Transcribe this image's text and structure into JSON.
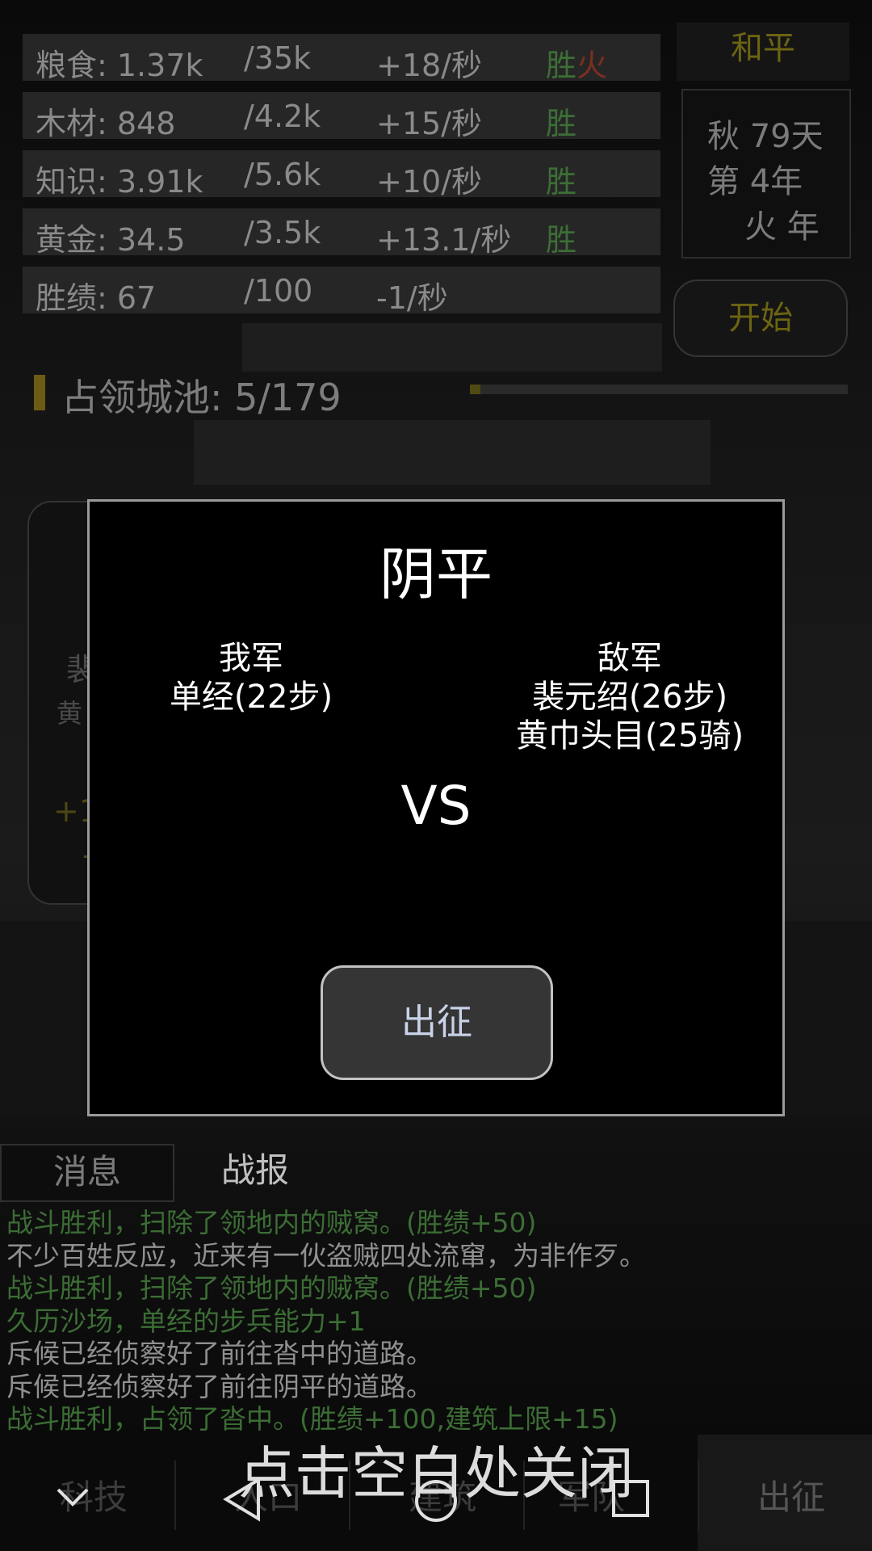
{
  "resources": [
    {
      "name": "粮食: 1.37k",
      "max": "/35k",
      "rate": "+18/秒",
      "status": "胜",
      "status_extra": "火"
    },
    {
      "name": "木材: 848",
      "max": "/4.2k",
      "rate": "+15/秒",
      "status": "胜",
      "status_extra": ""
    },
    {
      "name": "知识: 3.91k",
      "max": "/5.6k",
      "rate": "+10/秒",
      "status": "胜",
      "status_extra": ""
    },
    {
      "name": "黄金: 34.5",
      "max": "/3.5k",
      "rate": "+13.1/秒",
      "status": "胜",
      "status_extra": ""
    },
    {
      "name": "胜绩: 67",
      "max": "/100",
      "rate": "-1/秒",
      "status": "",
      "status_extra": ""
    }
  ],
  "header": {
    "peace": "和平",
    "season_day": "秋 79天",
    "year": "第 4年",
    "element_year": "火 年",
    "start_button": "开始"
  },
  "cities": {
    "label": "占领城池: 5/179",
    "progress_fraction": 0.028
  },
  "side_card": {
    "line1": "裴",
    "line2": "黄",
    "line3": "+1",
    "line4": "-"
  },
  "modal": {
    "title": "阴平",
    "my_side": {
      "label": "我军",
      "units": [
        "单经(22步)"
      ]
    },
    "enemy_side": {
      "label": "敌军",
      "units": [
        "裴元绍(26步)",
        "黄巾头目(25骑)"
      ]
    },
    "vs": "VS",
    "go_button": "出征"
  },
  "tabs": {
    "messages": "消息",
    "battle_report": "战报"
  },
  "log": [
    {
      "text": "战斗胜利，扫除了领地内的贼窝。(胜绩+50)",
      "type": "green"
    },
    {
      "text": "不少百姓反应，近来有一伙盗贼四处流窜，为非作歹。",
      "type": "gray"
    },
    {
      "text": "战斗胜利，扫除了领地内的贼窝。(胜绩+50)",
      "type": "green"
    },
    {
      "text": "久历沙场，单经的步兵能力+1",
      "type": "green"
    },
    {
      "text": "斥候已经侦察好了前往沓中的道路。",
      "type": "gray"
    },
    {
      "text": "斥候已经侦察好了前往阴平的道路。",
      "type": "gray"
    },
    {
      "text": "战斗胜利，占领了沓中。(胜绩+100,建筑上限+15)",
      "type": "green"
    }
  ],
  "bottom_nav": [
    "科技",
    "人口",
    "建筑",
    "军队",
    "出征"
  ],
  "close_hint": "点击空白处关闭",
  "system_icons": [
    "chevron-down-icon",
    "back-icon",
    "home-icon",
    "recents-icon"
  ]
}
